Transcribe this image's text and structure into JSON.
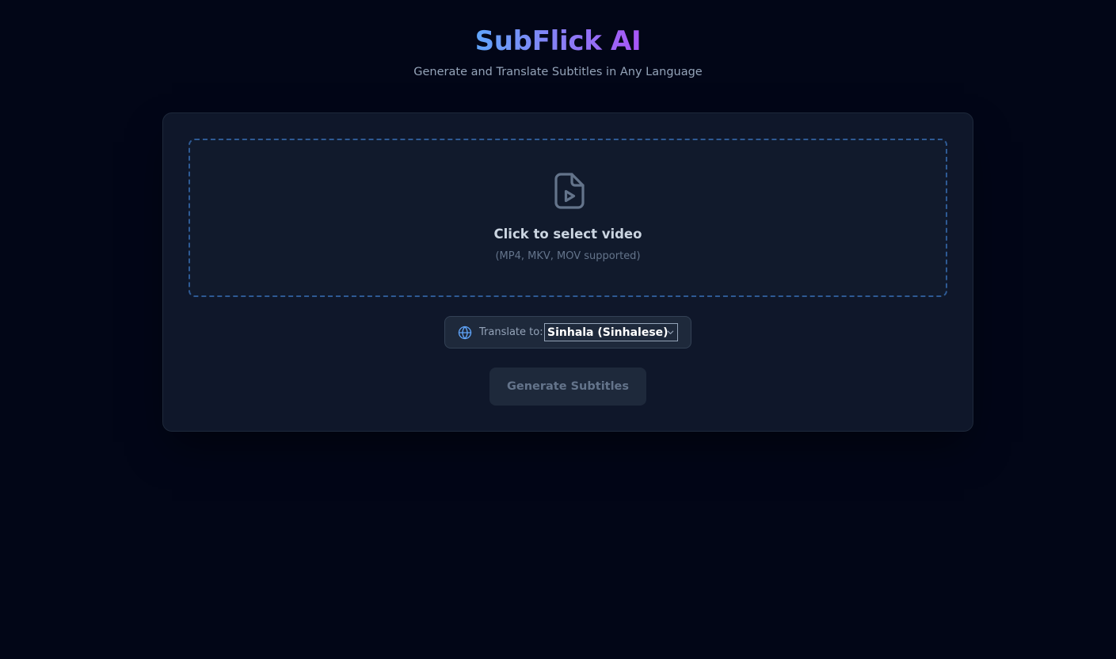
{
  "header": {
    "title": "SubFlick AI",
    "subtitle": "Generate and Translate Subtitles in Any Language"
  },
  "upload": {
    "icon": "file-video-icon",
    "title": "Click to select video",
    "hint": "(MP4, MKV, MOV supported)"
  },
  "translate": {
    "icon": "globe-icon",
    "label": "Translate to:",
    "selected_language": "Sinhala (Sinhalese)"
  },
  "actions": {
    "generate_label": "Generate Subtitles",
    "generate_enabled": false
  },
  "colors": {
    "background": "#020617",
    "card": "#0f172a",
    "accent_blue": "#60a5fa",
    "accent_purple": "#a855f7",
    "dashed_border": "#2e5a94"
  }
}
